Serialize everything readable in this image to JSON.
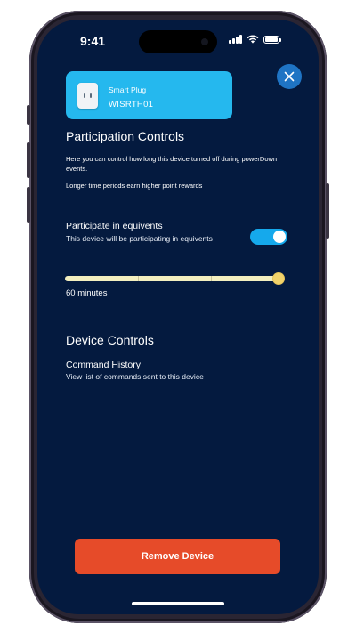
{
  "status_bar": {
    "time": "9:41"
  },
  "device": {
    "type_label": "Smart Plug",
    "name": "WISRTH01"
  },
  "participation": {
    "title": "Participation Controls",
    "description": "Here you can control how long this device turned off during powerDown events.",
    "note": "Longer time periods earn higher point rewards",
    "toggle_label": "Participate in equivents",
    "toggle_sublabel": "This device will be participating in equivents",
    "toggle_on": true
  },
  "duration_slider": {
    "value_minutes": 60,
    "max_minutes": 60,
    "value_label": "60 minutes"
  },
  "device_controls": {
    "title": "Device Controls",
    "command_history_label": "Command History",
    "command_history_sublabel": "View list of commands sent to this device"
  },
  "actions": {
    "remove_label": "Remove Device"
  },
  "colors": {
    "background": "#041a3f",
    "accent_card": "#25b8ee",
    "toggle_on": "#15a9ec",
    "remove_button": "#e64b29",
    "slider_track": "#f3efbf",
    "slider_thumb": "#f2d36b"
  }
}
